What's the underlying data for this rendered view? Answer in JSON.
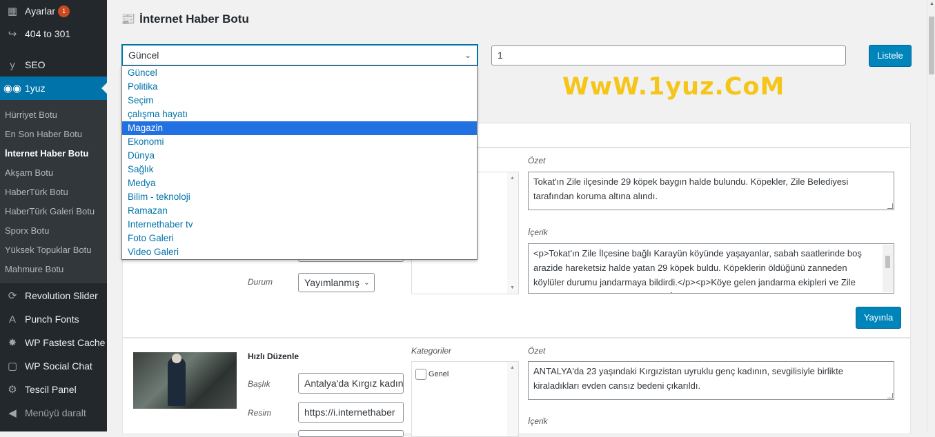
{
  "sidebar": {
    "items": [
      {
        "label": "Ayarlar",
        "icon": "settings-icon",
        "badge": "1"
      },
      {
        "label": "404 to 301",
        "icon": "redirect-icon"
      },
      {
        "label": "SEO",
        "icon": "yoast-icon"
      },
      {
        "label": "1yuz",
        "icon": "glasses-icon"
      },
      {
        "label": "Revolution Slider",
        "icon": "refresh-icon"
      },
      {
        "label": "Punch Fonts",
        "icon": "font-icon"
      },
      {
        "label": "WP Fastest Cache",
        "icon": "cheetah-icon"
      },
      {
        "label": "WP Social Chat",
        "icon": "chat-icon"
      },
      {
        "label": "Tescil Panel",
        "icon": "gear-icon"
      },
      {
        "label": "Menüyü daralt",
        "icon": "collapse-icon"
      }
    ],
    "badge_color": "#ca4a1f",
    "submenu": [
      "Hürriyet Botu",
      "En Son Haber Botu",
      "İnternet Haber Botu",
      "Akşam Botu",
      "HaberTürk Botu",
      "HaberTürk Galeri Botu",
      "Sporx Botu",
      "Yüksek Topuklar Botu",
      "Mahmure Botu"
    ]
  },
  "header": {
    "title": "İnternet Haber Botu",
    "icon": "newspaper-icon"
  },
  "filters": {
    "category_selected": "Güncel",
    "page_value": "1",
    "list_button": "Listele"
  },
  "dropdown": {
    "options": [
      "Güncel",
      "Politika",
      "Seçim",
      "çalışma hayatı",
      "Magazin",
      "Ekonomi",
      "Dünya",
      "Sağlık",
      "Medya",
      "Bilim - teknoloji",
      "Ramazan",
      "Internethaber tv",
      "Foto Galeri",
      "Video Galeri"
    ],
    "highlighted": "Magazin"
  },
  "watermark": "WwW.1yuz.CoM",
  "post1": {
    "status_label": "Durum",
    "status_value": "Yayımlanmış",
    "summary_label": "Özet",
    "summary": "Tokat'ın Zile ilçesinde 29 köpek baygın halde bulundu. Köpekler, Zile Belediyesi tarafından koruma altına alındı.",
    "content_label": "İçerik",
    "content": "<p>Tokat'ın Zile İlçesine bağlı Karayün köyünde yaşayanlar, sabah saatlerinde boş arazide hareketsiz halde yatan 29 köpek buldu. Köpeklerin öldüğünü zanneden köylüler durumu jandarmaya bildirdi.</p><p>Köye gelen jandarma ekipleri ve Zile Belediyesi Veteriner Hekimi Yaşar İz, köpeklerin baygın olduğunu",
    "publish_button": "Yayınla"
  },
  "post2": {
    "quick_edit_label": "Hızlı Düzenle",
    "title_label": "Başlık",
    "title_value": "Antalya'da Kırgız kadın",
    "image_label": "Resim",
    "image_value": "https://i.internethaber",
    "categories_label": "Kategoriler",
    "category_general": "Genel",
    "summary_label": "Özet",
    "summary": "ANTALYA'da 23 yaşındaki Kırgızistan uyruklu genç kadının, sevgilisiyle birlikte kiraladıkları evden cansız bedeni çıkarıldı.",
    "content_label": "İçerik"
  }
}
